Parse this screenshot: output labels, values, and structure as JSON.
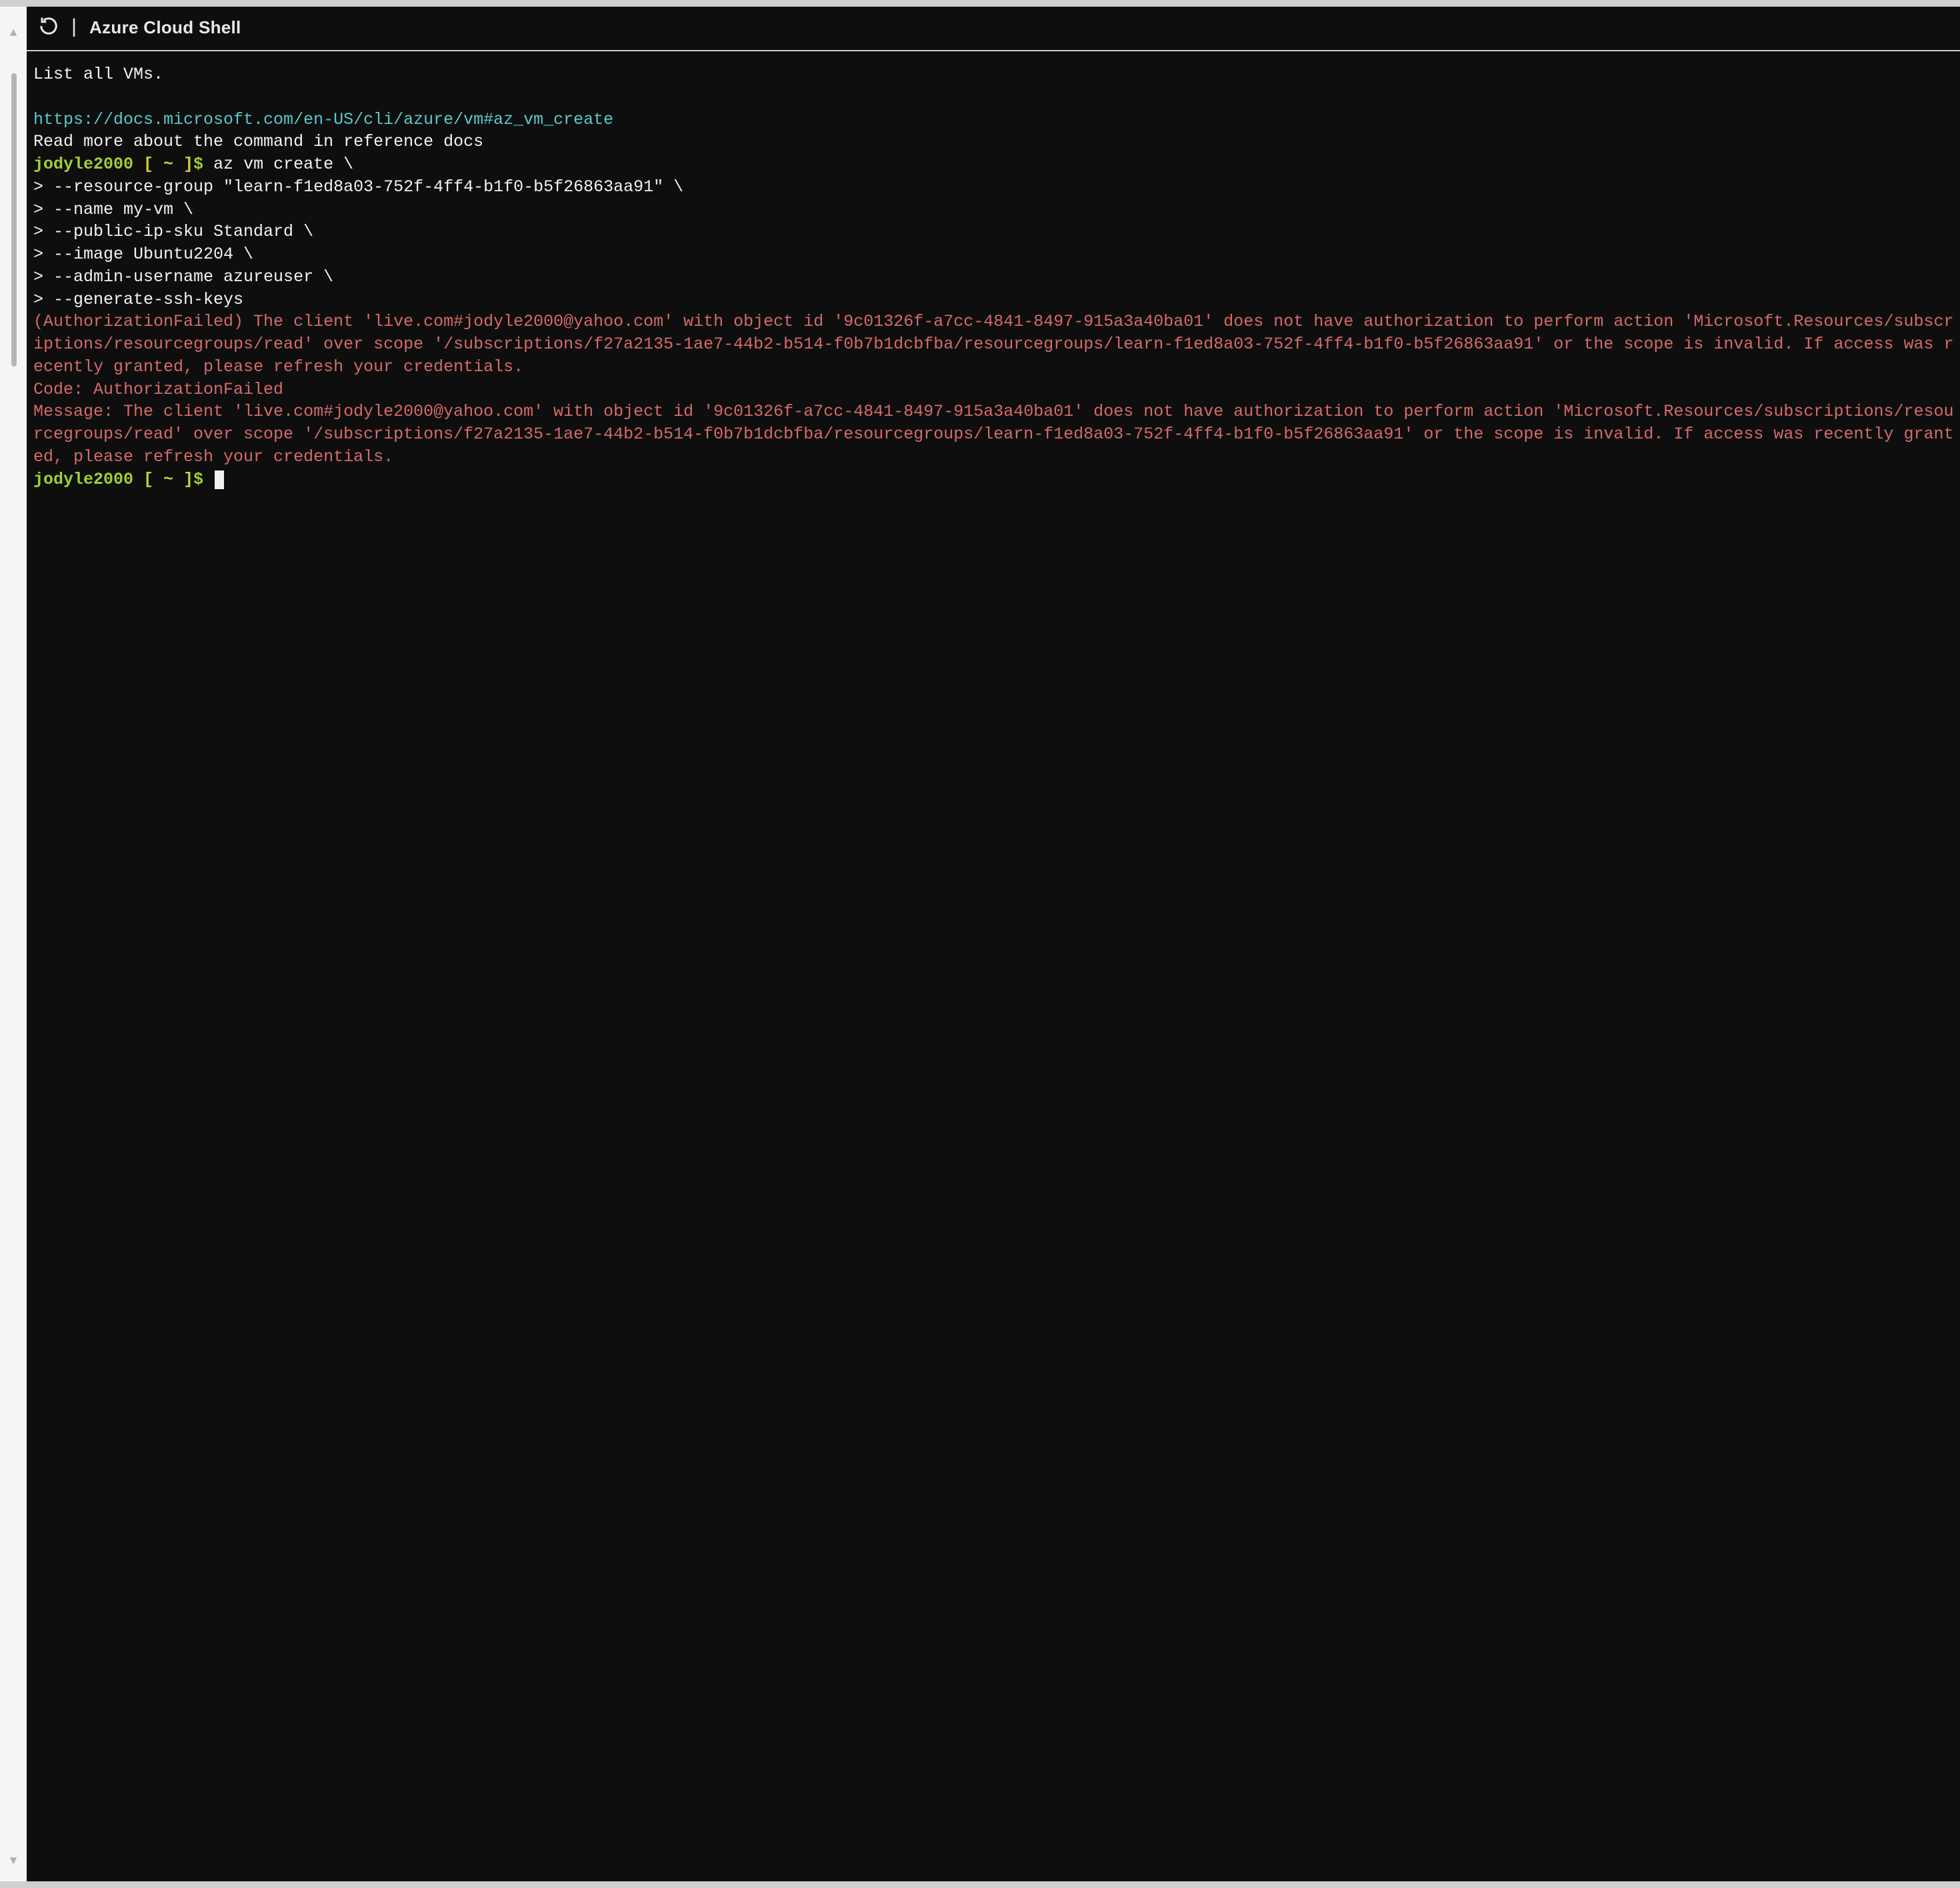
{
  "title_bar": {
    "refresh_icon": "refresh-icon",
    "title": "Azure Cloud Shell"
  },
  "terminal": {
    "intro_line": "List all VMs.",
    "doc_url": "https://docs.microsoft.com/en-US/cli/azure/vm#az_vm_create",
    "doc_hint": "Read more about the command in reference docs",
    "prompt_user": "jodyle2000",
    "prompt_path": " [ ~ ]",
    "prompt_symbol": "$ ",
    "command_first": "az vm create \\",
    "command_lines": [
      "> --resource-group \"learn-f1ed8a03-752f-4ff4-b1f0-b5f26863aa91\" \\",
      "> --name my-vm \\",
      "> --public-ip-sku Standard \\",
      "> --image Ubuntu2204 \\",
      "> --admin-username azureuser \\",
      "> --generate-ssh-keys"
    ],
    "error_block": "(AuthorizationFailed) The client 'live.com#jodyle2000@yahoo.com' with object id '9c01326f-a7cc-4841-8497-915a3a40ba01' does not have authorization to perform action 'Microsoft.Resources/subscriptions/resourcegroups/read' over scope '/subscriptions/f27a2135-1ae7-44b2-b514-f0b7b1dcbfba/resourcegroups/learn-f1ed8a03-752f-4ff4-b1f0-b5f26863aa91' or the scope is invalid. If access was recently granted, please refresh your credentials.\nCode: AuthorizationFailed\nMessage: The client 'live.com#jodyle2000@yahoo.com' with object id '9c01326f-a7cc-4841-8497-915a3a40ba01' does not have authorization to perform action 'Microsoft.Resources/subscriptions/resourcegroups/read' over scope '/subscriptions/f27a2135-1ae7-44b2-b514-f0b7b1dcbfba/resourcegroups/learn-f1ed8a03-752f-4ff4-b1f0-b5f26863aa91' or the scope is invalid. If access was recently granted, please refresh your credentials."
  },
  "colors": {
    "bg": "#0e0e0e",
    "fg": "#f2f2f2",
    "cyan": "#5bc8c8",
    "green": "#9fce3a",
    "yellow": "#cfcf3a",
    "red": "#d56a6a"
  },
  "gutter": {
    "up": "▲",
    "down": "▼"
  }
}
